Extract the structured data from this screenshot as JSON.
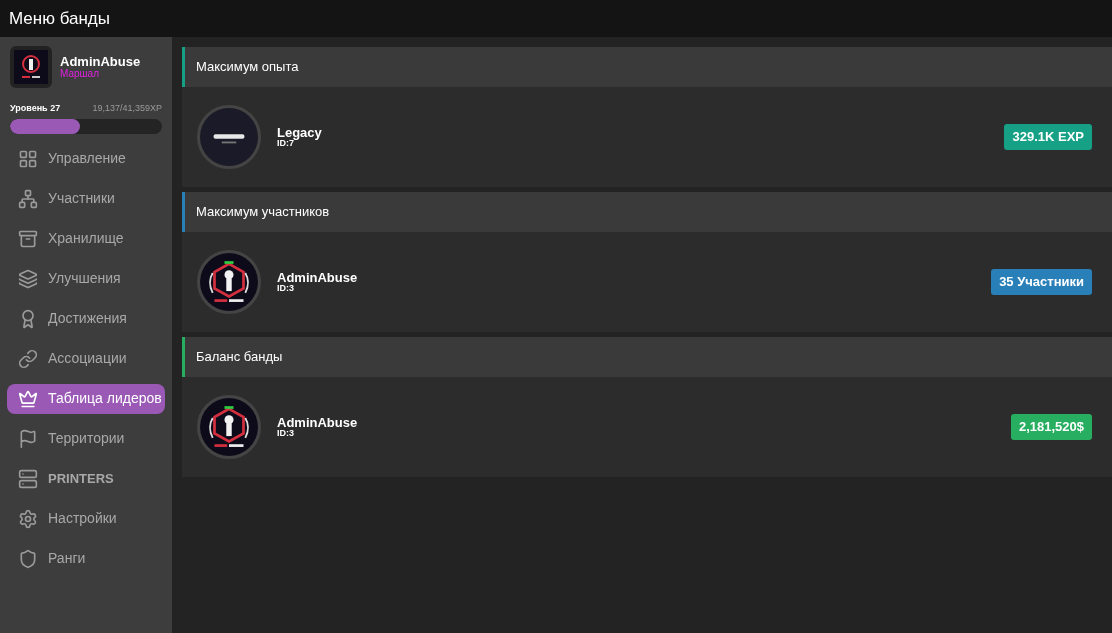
{
  "window": {
    "title": "Меню банды"
  },
  "profile": {
    "name": "AdminAbuse",
    "rank": "Маршал",
    "level_label": "Уровень 27",
    "xp": "19,137/41,359XP",
    "level": 0.46
  },
  "sidebar": {
    "items": [
      {
        "label": "Управление",
        "selected": false,
        "bold": false
      },
      {
        "label": "Участники",
        "selected": false,
        "bold": false
      },
      {
        "label": "Хранилище",
        "selected": false,
        "bold": false
      },
      {
        "label": "Улучшения",
        "selected": false,
        "bold": false
      },
      {
        "label": "Достижения",
        "selected": false,
        "bold": false
      },
      {
        "label": "Ассоциации",
        "selected": false,
        "bold": false
      },
      {
        "label": "Таблица лидеров",
        "selected": true,
        "bold": false
      },
      {
        "label": "Территории",
        "selected": false,
        "bold": false
      },
      {
        "label": "PRINTERS",
        "selected": false,
        "bold": true
      },
      {
        "label": "Настройки",
        "selected": false,
        "bold": false
      },
      {
        "label": "Ранги",
        "selected": false,
        "bold": false
      }
    ]
  },
  "sections": [
    {
      "title": "Максимум опыта",
      "color": "#16a085",
      "gang": "Legacy",
      "id": "ID:7",
      "badge": "329.1K EXP"
    },
    {
      "title": "Максимум участников",
      "color": "#2980b9",
      "gang": "AdminAbuse",
      "id": "ID:3",
      "badge": "35 Участники"
    },
    {
      "title": "Баланс банды",
      "color": "#27ae60",
      "gang": "AdminAbuse",
      "id": "ID:3",
      "badge": "2,181,520$"
    }
  ]
}
